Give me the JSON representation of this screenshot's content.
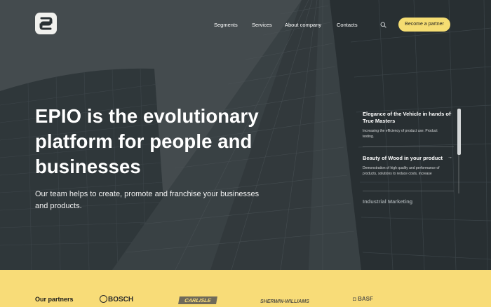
{
  "brand": {
    "logo_icon": "epio-logo-icon",
    "accent_color": "#f5dd72"
  },
  "nav": {
    "segments": "Segments",
    "services": "Services",
    "about": "About company",
    "contacts": "Contacts",
    "search_icon": "search-icon",
    "cta": "Become a partner"
  },
  "hero": {
    "headline_lines": [
      "EPIO is the evolutionary",
      "platform for people and",
      "businesses"
    ],
    "subtitle": "Our team helps to create, promote and franchise your businesses and products."
  },
  "cards": [
    {
      "title": "Elegance of the Vehicle in hands of True Masters",
      "text": "Increasing the efficiency of product use. Product testing."
    },
    {
      "title": "Beauty of Wood in your product",
      "text": "Demonstration of high quality and performance of products, solutions to reduce costs, increase"
    },
    {
      "title": "Industrial Marketing",
      "text": ""
    }
  ],
  "partners": {
    "title": "Our partners",
    "logos": [
      "BOSCH",
      "CARLISLE",
      "SHERWIN-WILLIAMS",
      "BASF"
    ]
  }
}
